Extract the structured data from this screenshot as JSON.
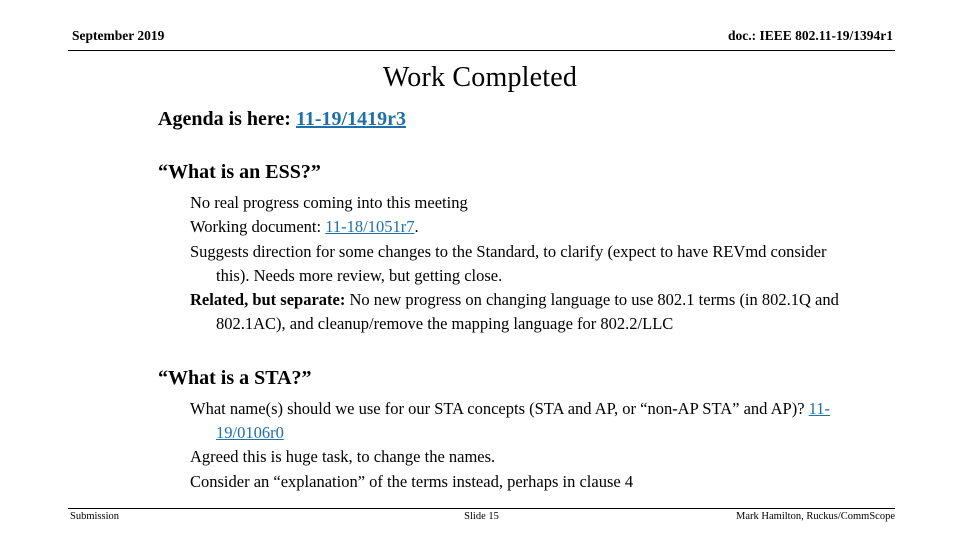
{
  "header": {
    "date": "September 2019",
    "doc_id": "doc.: IEEE 802.11-19/1394r1"
  },
  "title": "Work Completed",
  "link_color": "#1f6fa8",
  "agenda": {
    "label": "Agenda is here: ",
    "link": "11-19/1419r3"
  },
  "sections": [
    {
      "heading": "“What is an ESS?”",
      "items": [
        {
          "text": "No real progress coming into this meeting"
        },
        {
          "prefix": "Working document: ",
          "link": "11-18/1051r7",
          "suffix": "."
        },
        {
          "text": "Suggests direction for some changes to the Standard, to clarify (expect to have REVmd consider this).  Needs more review, but getting close."
        },
        {
          "bold_prefix": "Related, but separate:",
          "text": " No new progress on changing language to use 802.1 terms (in 802.1Q and 802.1AC), and cleanup/remove the mapping language for 802.2/LLC"
        }
      ]
    },
    {
      "heading": "“What is a STA?”",
      "items": [
        {
          "prefix": "What name(s) should we use for our STA concepts (STA and AP, or “non-AP STA” and AP)? ",
          "link": "11-19/0106r0"
        },
        {
          "text": "Agreed this is huge task, to change the names."
        },
        {
          "text": "Consider an “explanation” of the terms instead, perhaps in clause 4"
        }
      ]
    }
  ],
  "footer": {
    "left": "Submission",
    "center": "Slide 15",
    "right": "Mark Hamilton, Ruckus/CommScope"
  }
}
